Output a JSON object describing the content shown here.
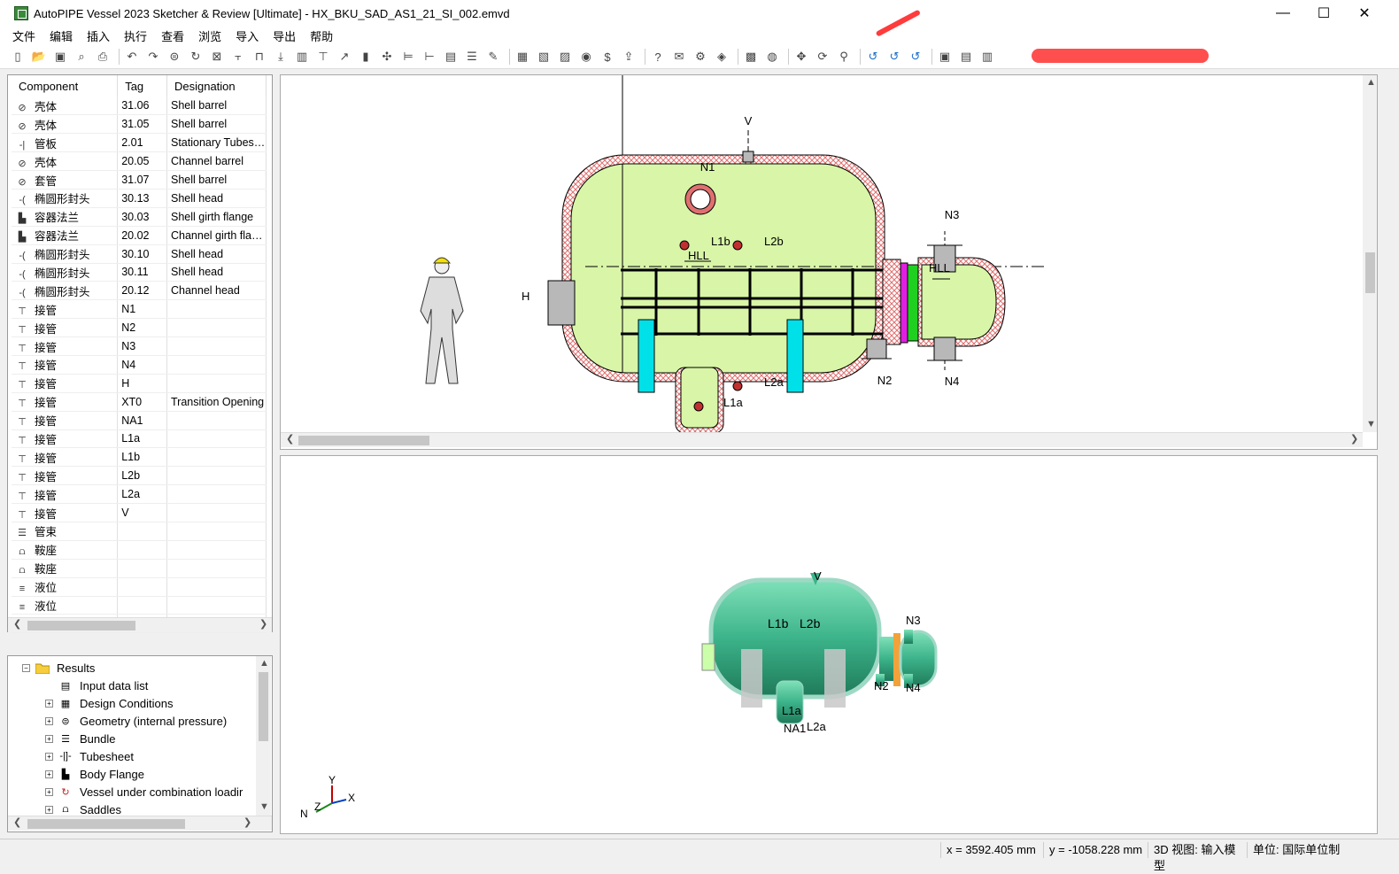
{
  "window": {
    "title": "AutoPIPE Vessel 2023 Sketcher & Review [Ultimate] - HX_BKU_SAD_AS1_21_SI_002.emvd",
    "minimize": "—",
    "maximize": "☐",
    "close": "✕"
  },
  "menu": [
    "文件",
    "编辑",
    "插入",
    "执行",
    "查看",
    "浏览",
    "导入",
    "导出",
    "帮助"
  ],
  "toolbar": {
    "icons": [
      "new-icon",
      "open-icon",
      "save-icon",
      "preview-icon",
      "print-icon",
      "undo-icon",
      "redo-icon",
      "shell-icon",
      "rotate-icon",
      "box-icon",
      "hline-icon",
      "support-icon",
      "insert-icon",
      "bundle-icon",
      "nozzle-icon",
      "arrow-icon",
      "flange-icon",
      "cross-icon",
      "align-icon",
      "tree-icon",
      "table-icon",
      "list-icon",
      "edit-icon",
      "calc-icon",
      "report-icon",
      "page-icon",
      "eye-icon",
      "dollar-icon",
      "export-icon",
      "help-icon",
      "mail-icon",
      "settings-icon",
      "layers-icon",
      "map-icon",
      "globe-icon",
      "move-icon",
      "refresh-icon",
      "zoom-icon",
      "rot-x-icon",
      "rot-y-icon",
      "rot-z-icon",
      "view1-icon",
      "view2-icon",
      "view3-icon"
    ],
    "axis_labels": [
      "X",
      "Y",
      "Z"
    ]
  },
  "components": {
    "headers": [
      "Component",
      "Tag",
      "Designation"
    ],
    "rows": [
      {
        "icon": "shell-icon",
        "component": "壳体",
        "tag": "31.06",
        "designation": "Shell barrel"
      },
      {
        "icon": "shell-icon",
        "component": "壳体",
        "tag": "31.05",
        "designation": "Shell barrel"
      },
      {
        "icon": "tubesheet-icon",
        "component": "管板",
        "tag": "2.01",
        "designation": "Stationary Tubesheet"
      },
      {
        "icon": "shell-icon",
        "component": "壳体",
        "tag": "20.05",
        "designation": "Channel barrel"
      },
      {
        "icon": "shell-icon",
        "component": "套管",
        "tag": "31.07",
        "designation": "Shell barrel"
      },
      {
        "icon": "head-icon",
        "component": "椭圆形封头",
        "tag": "30.13",
        "designation": "Shell head"
      },
      {
        "icon": "flange-icon",
        "component": "容器法兰",
        "tag": "30.03",
        "designation": "Shell girth flange"
      },
      {
        "icon": "flange-icon",
        "component": "容器法兰",
        "tag": "20.02",
        "designation": "Channel girth flange"
      },
      {
        "icon": "head-icon",
        "component": "椭圆形封头",
        "tag": "30.10",
        "designation": "Shell head"
      },
      {
        "icon": "head-icon",
        "component": "椭圆形封头",
        "tag": "30.11",
        "designation": "Shell head"
      },
      {
        "icon": "head-icon",
        "component": "椭圆形封头",
        "tag": "20.12",
        "designation": "Channel head"
      },
      {
        "icon": "nozzle-icon",
        "component": "接管",
        "tag": "N1",
        "designation": ""
      },
      {
        "icon": "nozzle-icon",
        "component": "接管",
        "tag": "N2",
        "designation": ""
      },
      {
        "icon": "nozzle-icon",
        "component": "接管",
        "tag": "N3",
        "designation": ""
      },
      {
        "icon": "nozzle-icon",
        "component": "接管",
        "tag": "N4",
        "designation": ""
      },
      {
        "icon": "nozzle-icon",
        "component": "接管",
        "tag": "H",
        "designation": ""
      },
      {
        "icon": "nozzle-icon",
        "component": "接管",
        "tag": "XT0",
        "designation": "Transition Opening"
      },
      {
        "icon": "nozzle-icon",
        "component": "接管",
        "tag": "NA1",
        "designation": ""
      },
      {
        "icon": "nozzle-icon",
        "component": "接管",
        "tag": "L1a",
        "designation": ""
      },
      {
        "icon": "nozzle-icon",
        "component": "接管",
        "tag": "L1b",
        "designation": ""
      },
      {
        "icon": "nozzle-icon",
        "component": "接管",
        "tag": "L2b",
        "designation": ""
      },
      {
        "icon": "nozzle-icon",
        "component": "接管",
        "tag": "L2a",
        "designation": ""
      },
      {
        "icon": "nozzle-icon",
        "component": "接管",
        "tag": "V",
        "designation": ""
      },
      {
        "icon": "bundle-icon",
        "component": "管束",
        "tag": "",
        "designation": ""
      },
      {
        "icon": "saddle-icon",
        "component": "鞍座",
        "tag": "",
        "designation": ""
      },
      {
        "icon": "saddle-icon",
        "component": "鞍座",
        "tag": "",
        "designation": ""
      },
      {
        "icon": "level-icon",
        "component": "液位",
        "tag": "",
        "designation": ""
      },
      {
        "icon": "level-icon",
        "component": "液位",
        "tag": "",
        "designation": ""
      }
    ]
  },
  "tree": {
    "root": "Results",
    "items": [
      {
        "label": "Input data list",
        "expandable": false,
        "icon": "list-icon"
      },
      {
        "label": "Design Conditions",
        "expandable": true,
        "icon": "conditions-icon"
      },
      {
        "label": "Geometry (internal pressure)",
        "expandable": true,
        "icon": "geometry-icon"
      },
      {
        "label": "Bundle",
        "expandable": true,
        "icon": "bundle-icon"
      },
      {
        "label": "Tubesheet",
        "expandable": true,
        "icon": "tubesheet-icon"
      },
      {
        "label": "Body Flange",
        "expandable": true,
        "icon": "flange-icon"
      },
      {
        "label": "Vessel under combination loadir",
        "expandable": true,
        "icon": "combination-icon"
      },
      {
        "label": "Saddles",
        "expandable": true,
        "icon": "saddle-icon"
      }
    ]
  },
  "sketch": {
    "labels": {
      "v": "V",
      "n1": "N1",
      "n2": "N2",
      "n3": "N3",
      "n4": "N4",
      "h": "H",
      "l1a": "L1a",
      "l1b": "L1b",
      "l2a": "L2a",
      "l2b": "L2b",
      "hll1": "HLL",
      "hll2": "HLL"
    },
    "colors": {
      "shell_fill": "#d9f5a8",
      "insulation": "#e07070",
      "saddle": "#00e0e8",
      "flange_magenta": "#e020e0",
      "flange_green": "#20d020",
      "nozzle_gray": "#b8b8b8"
    }
  },
  "model3d": {
    "labels": {
      "v": "V",
      "l1b": "L1b",
      "l2b": "L2b",
      "n3": "N3",
      "n2": "N2",
      "n4": "N4",
      "l1a": "L1a",
      "na1": "NA1",
      "l2a": "L2a"
    },
    "axes": {
      "x": "X",
      "y": "Y",
      "z": "Z",
      "n": "N"
    },
    "color": "#3cb38a"
  },
  "status": {
    "x": "x = 3592.405 mm",
    "y": "y = -1058.228 mm",
    "view": "3D 视图: 输入模型",
    "units": "单位: 国际单位制"
  }
}
